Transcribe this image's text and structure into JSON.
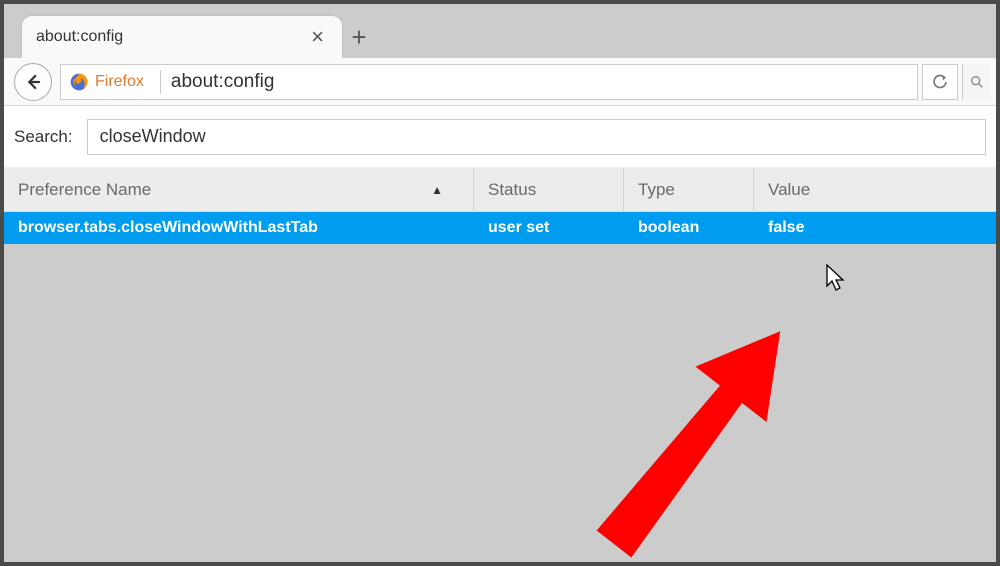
{
  "tab": {
    "title": "about:config"
  },
  "urlbar": {
    "brand": "Firefox",
    "url": "about:config"
  },
  "search": {
    "label": "Search:",
    "value": "closeWindow"
  },
  "columns": {
    "name": "Preference Name",
    "status": "Status",
    "type": "Type",
    "value": "Value"
  },
  "rows": [
    {
      "name": "browser.tabs.closeWindowWithLastTab",
      "status": "user set",
      "type": "boolean",
      "value": "false",
      "selected": true
    }
  ],
  "colors": {
    "selected_row": "#009cef",
    "firefox_orange": "#e07b2e",
    "annotation_red": "#ff0000"
  }
}
